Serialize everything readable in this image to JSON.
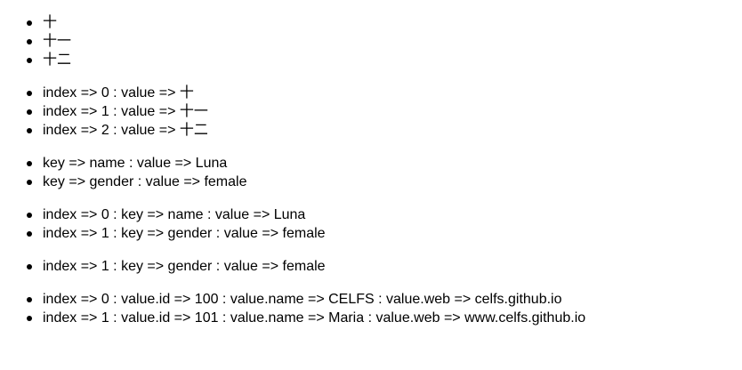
{
  "lists": [
    {
      "items": [
        "十",
        "十一",
        "十二"
      ]
    },
    {
      "items": [
        "index => 0 : value => 十",
        "index => 1 : value => 十一",
        "index => 2 : value => 十二"
      ]
    },
    {
      "items": [
        "key => name : value => Luna",
        "key => gender : value => female"
      ]
    },
    {
      "items": [
        "index => 0 : key => name : value => Luna",
        "index => 1 : key => gender : value => female"
      ]
    },
    {
      "items": [
        "index => 1 : key => gender : value => female"
      ]
    },
    {
      "items": [
        "index => 0 : value.id => 100 : value.name => CELFS : value.web => celfs.github.io",
        "index => 1 : value.id => 101 : value.name => Maria : value.web => www.celfs.github.io"
      ]
    }
  ]
}
